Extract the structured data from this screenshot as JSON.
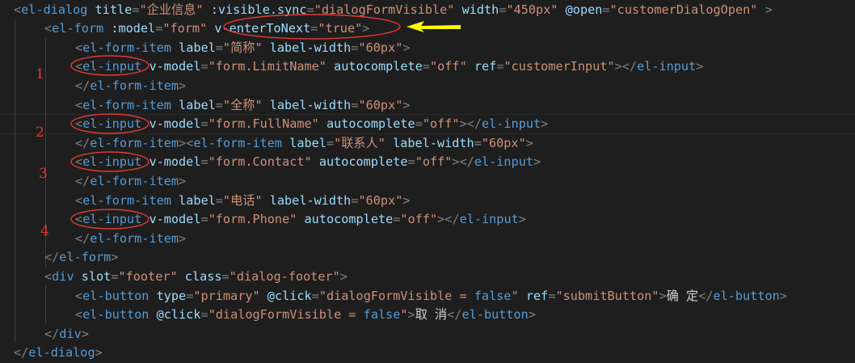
{
  "editor": {
    "lines": [
      {
        "indent": 0,
        "tokens": [
          [
            "punc",
            "<"
          ],
          [
            "tag",
            "el-dialog"
          ],
          [
            "text",
            " "
          ],
          [
            "attr",
            "title"
          ],
          [
            "punc",
            "="
          ],
          [
            "str",
            "\"企业信息\""
          ],
          [
            "text",
            " "
          ],
          [
            "attr",
            ":visible.sync"
          ],
          [
            "punc",
            "="
          ],
          [
            "str",
            "\"dialogFormVisible\""
          ],
          [
            "text",
            " "
          ],
          [
            "attr",
            "width"
          ],
          [
            "punc",
            "="
          ],
          [
            "str",
            "\"450px\""
          ],
          [
            "text",
            " "
          ],
          [
            "attr",
            "@open"
          ],
          [
            "punc",
            "="
          ],
          [
            "str",
            "\"customerDialogOpen\""
          ],
          [
            "text",
            " "
          ],
          [
            "punc",
            ">"
          ]
        ]
      },
      {
        "indent": 1,
        "tokens": [
          [
            "punc",
            "<"
          ],
          [
            "tag",
            "el-form"
          ],
          [
            "text",
            " "
          ],
          [
            "attr",
            ":model"
          ],
          [
            "punc",
            "="
          ],
          [
            "str",
            "\"form\""
          ],
          [
            "text",
            " "
          ],
          [
            "attr",
            "v-enterToNext"
          ],
          [
            "punc",
            "="
          ],
          [
            "str",
            "\"true\""
          ],
          [
            "punc",
            ">"
          ]
        ]
      },
      {
        "indent": 2,
        "tokens": [
          [
            "punc",
            "<"
          ],
          [
            "tag",
            "el-form-item"
          ],
          [
            "text",
            " "
          ],
          [
            "attr",
            "label"
          ],
          [
            "punc",
            "="
          ],
          [
            "str",
            "\"简称\""
          ],
          [
            "text",
            " "
          ],
          [
            "attr",
            "label-width"
          ],
          [
            "punc",
            "="
          ],
          [
            "str",
            "\"60px\""
          ],
          [
            "punc",
            ">"
          ]
        ]
      },
      {
        "indent": 2,
        "tokens": [
          [
            "punc",
            "<"
          ],
          [
            "tag",
            "el-input"
          ],
          [
            "text",
            " "
          ],
          [
            "attr",
            "v-model"
          ],
          [
            "punc",
            "="
          ],
          [
            "str",
            "\"form.LimitName\""
          ],
          [
            "text",
            " "
          ],
          [
            "attr",
            "autocomplete"
          ],
          [
            "punc",
            "="
          ],
          [
            "str",
            "\"off\""
          ],
          [
            "text",
            " "
          ],
          [
            "attr",
            "ref"
          ],
          [
            "punc",
            "="
          ],
          [
            "str",
            "\"customerInput\""
          ],
          [
            "punc",
            "></"
          ],
          [
            "tag",
            "el-input"
          ],
          [
            "punc",
            ">"
          ]
        ]
      },
      {
        "indent": 2,
        "tokens": [
          [
            "punc",
            "</"
          ],
          [
            "tag",
            "el-form-item"
          ],
          [
            "punc",
            ">"
          ]
        ]
      },
      {
        "indent": 2,
        "tokens": [
          [
            "punc",
            "<"
          ],
          [
            "tag",
            "el-form-item"
          ],
          [
            "text",
            " "
          ],
          [
            "attr",
            "label"
          ],
          [
            "punc",
            "="
          ],
          [
            "str",
            "\"全称\""
          ],
          [
            "text",
            " "
          ],
          [
            "attr",
            "label-width"
          ],
          [
            "punc",
            "="
          ],
          [
            "str",
            "\"60px\""
          ],
          [
            "punc",
            ">"
          ]
        ]
      },
      {
        "indent": 2,
        "tokens": [
          [
            "punc",
            "<"
          ],
          [
            "tag",
            "el-input"
          ],
          [
            "text",
            " "
          ],
          [
            "attr",
            "v-model"
          ],
          [
            "punc",
            "="
          ],
          [
            "str",
            "\"form.FullName\""
          ],
          [
            "text",
            " "
          ],
          [
            "attr",
            "autocomplete"
          ],
          [
            "punc",
            "="
          ],
          [
            "str",
            "\"off\""
          ],
          [
            "punc",
            "></"
          ],
          [
            "tag",
            "el-input"
          ],
          [
            "punc",
            ">"
          ]
        ]
      },
      {
        "indent": 2,
        "tokens": [
          [
            "punc",
            "</"
          ],
          [
            "tag",
            "el-form-item"
          ],
          [
            "punc",
            "><"
          ],
          [
            "tag",
            "el-form-item"
          ],
          [
            "text",
            " "
          ],
          [
            "attr",
            "label"
          ],
          [
            "punc",
            "="
          ],
          [
            "str",
            "\"联系人\""
          ],
          [
            "text",
            " "
          ],
          [
            "attr",
            "label-width"
          ],
          [
            "punc",
            "="
          ],
          [
            "str",
            "\"60px\""
          ],
          [
            "punc",
            ">"
          ]
        ]
      },
      {
        "indent": 2,
        "tokens": [
          [
            "punc",
            "<"
          ],
          [
            "tag",
            "el-input"
          ],
          [
            "text",
            " "
          ],
          [
            "attr",
            "v-model"
          ],
          [
            "punc",
            "="
          ],
          [
            "str",
            "\"form.Contact\""
          ],
          [
            "text",
            " "
          ],
          [
            "attr",
            "autocomplete"
          ],
          [
            "punc",
            "="
          ],
          [
            "str",
            "\"off\""
          ],
          [
            "punc",
            "></"
          ],
          [
            "tag",
            "el-input"
          ],
          [
            "punc",
            ">"
          ]
        ]
      },
      {
        "indent": 2,
        "tokens": [
          [
            "punc",
            "</"
          ],
          [
            "tag",
            "el-form-item"
          ],
          [
            "punc",
            ">"
          ]
        ]
      },
      {
        "indent": 2,
        "tokens": [
          [
            "punc",
            "<"
          ],
          [
            "tag",
            "el-form-item"
          ],
          [
            "text",
            " "
          ],
          [
            "attr",
            "label"
          ],
          [
            "punc",
            "="
          ],
          [
            "str",
            "\"电话\""
          ],
          [
            "text",
            " "
          ],
          [
            "attr",
            "label-width"
          ],
          [
            "punc",
            "="
          ],
          [
            "str",
            "\"60px\""
          ],
          [
            "punc",
            ">"
          ]
        ]
      },
      {
        "indent": 2,
        "tokens": [
          [
            "punc",
            "<"
          ],
          [
            "tag",
            "el-input"
          ],
          [
            "text",
            " "
          ],
          [
            "attr",
            "v-model"
          ],
          [
            "punc",
            "="
          ],
          [
            "str",
            "\"form.Phone\""
          ],
          [
            "text",
            " "
          ],
          [
            "attr",
            "autocomplete"
          ],
          [
            "punc",
            "="
          ],
          [
            "str",
            "\"off\""
          ],
          [
            "punc",
            "></"
          ],
          [
            "tag",
            "el-input"
          ],
          [
            "punc",
            ">"
          ]
        ]
      },
      {
        "indent": 2,
        "tokens": [
          [
            "punc",
            "</"
          ],
          [
            "tag",
            "el-form-item"
          ],
          [
            "punc",
            ">"
          ]
        ]
      },
      {
        "indent": 1,
        "tokens": [
          [
            "punc",
            "</"
          ],
          [
            "tag",
            "el-form"
          ],
          [
            "punc",
            ">"
          ]
        ]
      },
      {
        "indent": 1,
        "tokens": [
          [
            "punc",
            "<"
          ],
          [
            "tag",
            "div"
          ],
          [
            "text",
            " "
          ],
          [
            "attr",
            "slot"
          ],
          [
            "punc",
            "="
          ],
          [
            "str",
            "\"footer\""
          ],
          [
            "text",
            " "
          ],
          [
            "attr",
            "class"
          ],
          [
            "punc",
            "="
          ],
          [
            "str",
            "\"dialog-footer\""
          ],
          [
            "punc",
            ">"
          ]
        ]
      },
      {
        "indent": 2,
        "tokens": [
          [
            "punc",
            "<"
          ],
          [
            "tag",
            "el-button"
          ],
          [
            "text",
            " "
          ],
          [
            "attr",
            "type"
          ],
          [
            "punc",
            "="
          ],
          [
            "str",
            "\"primary\""
          ],
          [
            "text",
            " "
          ],
          [
            "attr",
            "@click"
          ],
          [
            "punc",
            "="
          ],
          [
            "str",
            "\"dialogFormVisible = "
          ],
          [
            "kw",
            "false"
          ],
          [
            "str",
            "\""
          ],
          [
            "text",
            " "
          ],
          [
            "attr",
            "ref"
          ],
          [
            "punc",
            "="
          ],
          [
            "str",
            "\"submitButton\""
          ],
          [
            "punc",
            ">"
          ],
          [
            "text",
            "确 定"
          ],
          [
            "punc",
            "</"
          ],
          [
            "tag",
            "el-button"
          ],
          [
            "punc",
            ">"
          ]
        ]
      },
      {
        "indent": 2,
        "tokens": [
          [
            "punc",
            "<"
          ],
          [
            "tag",
            "el-button"
          ],
          [
            "text",
            " "
          ],
          [
            "attr",
            "@click"
          ],
          [
            "punc",
            "="
          ],
          [
            "str",
            "\"dialogFormVisible = "
          ],
          [
            "kw",
            "false"
          ],
          [
            "str",
            "\""
          ],
          [
            "punc",
            ">"
          ],
          [
            "text",
            "取 消"
          ],
          [
            "punc",
            "</"
          ],
          [
            "tag",
            "el-button"
          ],
          [
            "punc",
            ">"
          ]
        ]
      },
      {
        "indent": 1,
        "tokens": [
          [
            "punc",
            "</"
          ],
          [
            "tag",
            "div"
          ],
          [
            "punc",
            ">"
          ]
        ]
      },
      {
        "indent": 0,
        "tokens": [
          [
            "punc",
            "</"
          ],
          [
            "tag",
            "el-dialog"
          ],
          [
            "punc",
            ">"
          ]
        ]
      }
    ]
  },
  "annotations": {
    "color": "#e53935",
    "arrow_color": "#ffff00",
    "arrow_icon": "left-arrow-icon",
    "numbers": [
      "1",
      "2",
      "3",
      "4"
    ]
  },
  "theme": {
    "background": "#1e1e1e",
    "tag": "#569cd6",
    "attribute": "#9cdcfe",
    "string": "#ce9178",
    "punctuation": "#808080",
    "text": "#d4d4d4"
  }
}
